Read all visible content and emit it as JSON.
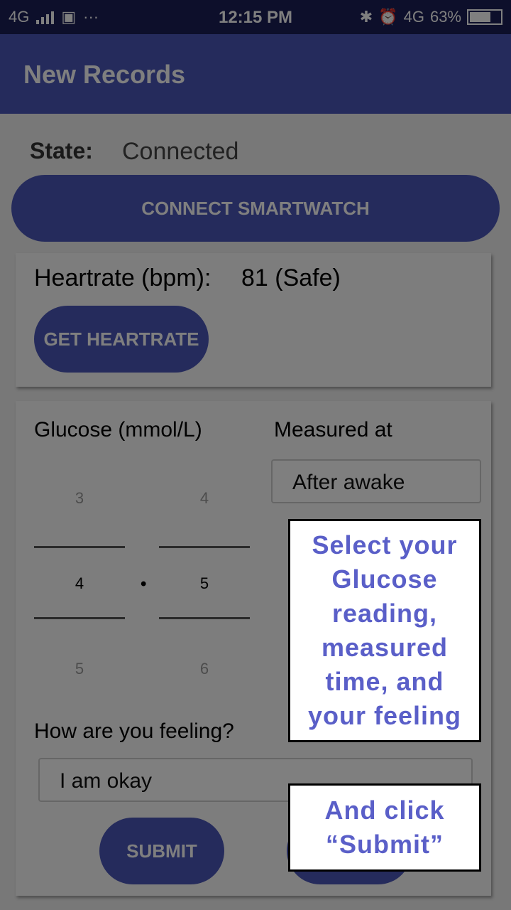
{
  "status_bar": {
    "network_label": "4G",
    "network_label_right": "4G",
    "time": "12:15 PM",
    "battery_percent": "63%",
    "battery_level": 0.63
  },
  "app_bar": {
    "title": "New Records"
  },
  "state": {
    "label": "State:",
    "value": "Connected"
  },
  "connect_button": "CONNECT SMARTWATCH",
  "heartrate": {
    "label": "Heartrate (bpm):",
    "value": "81 (Safe)",
    "button": "GET HEARTRATE"
  },
  "glucose": {
    "label": "Glucose (mmol/L)",
    "integer_picker": {
      "above": "3",
      "selected": "4",
      "below": "5"
    },
    "decimal_picker": {
      "above": "4",
      "selected": "5",
      "below": "6"
    },
    "separator": "•"
  },
  "measured": {
    "label": "Measured at",
    "selected": "After awake"
  },
  "feeling": {
    "label": "How are you feeling?",
    "value": "I am okay"
  },
  "submit_button": "SUBMIT",
  "tips": {
    "tip1": "Select your Glucose reading, measured time, and your feeling",
    "tip2": "And click “Submit”"
  },
  "colors": {
    "primary": "#4b56b8",
    "status_bar": "#1a1e57",
    "tip_text": "#5a5fc8"
  }
}
